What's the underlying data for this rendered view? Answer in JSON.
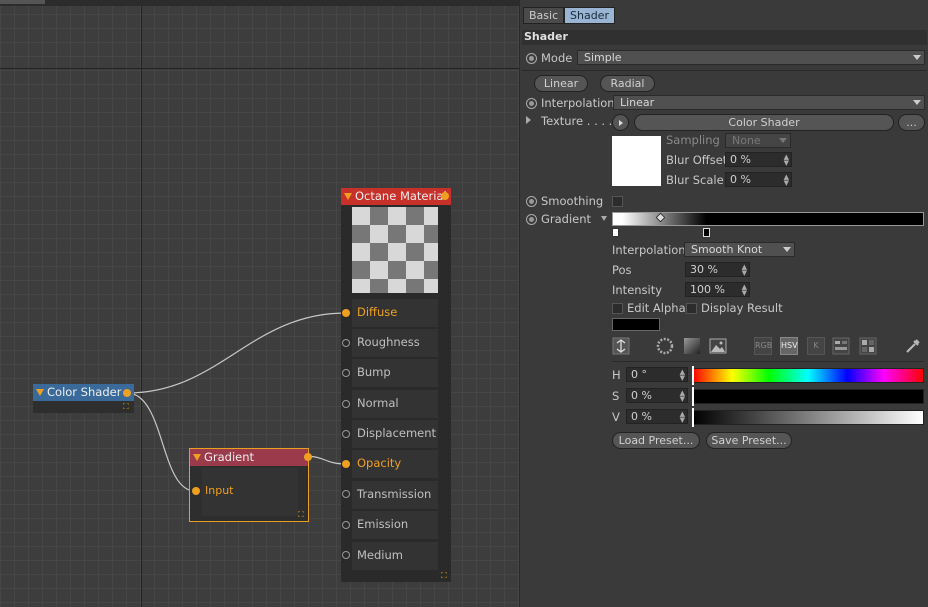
{
  "editor": {
    "nodes": {
      "color_shader": {
        "title": "Color Shader"
      },
      "gradient": {
        "title": "Gradient",
        "input_label": "Input"
      },
      "octane": {
        "title": "Octane Material",
        "slots": [
          "Diffuse",
          "Roughness",
          "Bump",
          "Normal",
          "Displacement",
          "Opacity",
          "Transmission",
          "Emission",
          "Medium"
        ],
        "connected_slots": [
          "Diffuse",
          "Opacity"
        ]
      }
    }
  },
  "panel": {
    "tabs": [
      "Basic",
      "Shader"
    ],
    "active_tab": "Shader",
    "section_title": "Shader",
    "mode": {
      "label": "Mode",
      "value": "Simple"
    },
    "gradient_type_buttons": [
      "Linear",
      "Radial"
    ],
    "interpolation": {
      "label": "Interpolation",
      "value": "Linear"
    },
    "texture": {
      "label": "Texture . . . . .",
      "value": "Color Shader",
      "more": "..."
    },
    "sampling": {
      "label": "Sampling",
      "value": "None"
    },
    "blur_offset": {
      "label": "Blur Offset",
      "value": "0 %"
    },
    "blur_scale": {
      "label": "Blur Scale",
      "value": "0 %"
    },
    "smoothing": {
      "label": "Smoothing"
    },
    "gradient": {
      "label": "Gradient"
    },
    "knot_interpolation": {
      "label": "Interpolation",
      "value": "Smooth Knot"
    },
    "pos": {
      "label": "Pos",
      "value": "30 %"
    },
    "intensity": {
      "label": "Intensity",
      "value": "100 %"
    },
    "edit_alpha": {
      "label": "Edit Alpha"
    },
    "display_result": {
      "label": "Display Result"
    },
    "color_modes": [
      "RGB",
      "HSV",
      "K"
    ],
    "active_color_mode": "HSV",
    "hsv": {
      "h": {
        "label": "H",
        "value": "0 °"
      },
      "s": {
        "label": "S",
        "value": "0 %"
      },
      "v": {
        "label": "V",
        "value": "0 %"
      }
    },
    "load_preset": "Load Preset...",
    "save_preset": "Save Preset..."
  },
  "colors": {
    "accent_orange": "#f0a020",
    "octane_header": "#c8302a",
    "gradient_header": "#9a3a4a",
    "color_shader_header": "#3a6a9a",
    "active_tab": "#9ab4d4"
  }
}
